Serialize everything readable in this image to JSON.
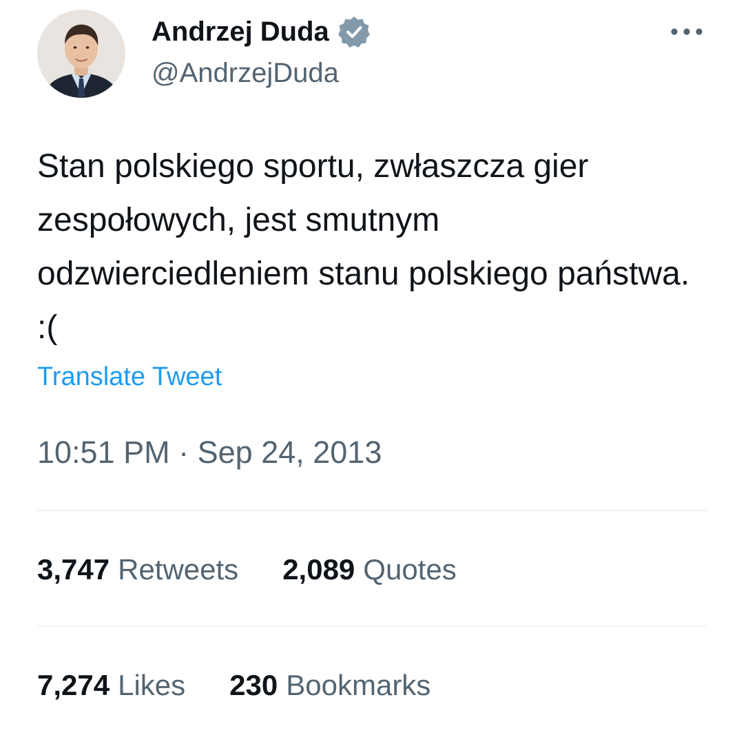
{
  "author": {
    "display_name": "Andrzej Duda",
    "handle": "@AndrzejDuda",
    "verified_icon": "verified-badge-icon",
    "verified_color": "#829aab"
  },
  "tweet": {
    "text": "Stan polskiego sportu, zwłaszcza gier zespołowych, jest smutnym odzwierciedleniem stanu polskiego państwa. :(",
    "translate_label": "Translate Tweet",
    "time": "10:51 PM",
    "separator": " · ",
    "date": "Sep 24, 2013"
  },
  "stats": {
    "retweets": {
      "count": "3,747",
      "label": "Retweets"
    },
    "quotes": {
      "count": "2,089",
      "label": "Quotes"
    },
    "likes": {
      "count": "7,274",
      "label": "Likes"
    },
    "bookmarks": {
      "count": "230",
      "label": "Bookmarks"
    }
  },
  "colors": {
    "text": "#0f1419",
    "secondary": "#536471",
    "link": "#1d9bf0",
    "divider": "#eff3f4"
  }
}
